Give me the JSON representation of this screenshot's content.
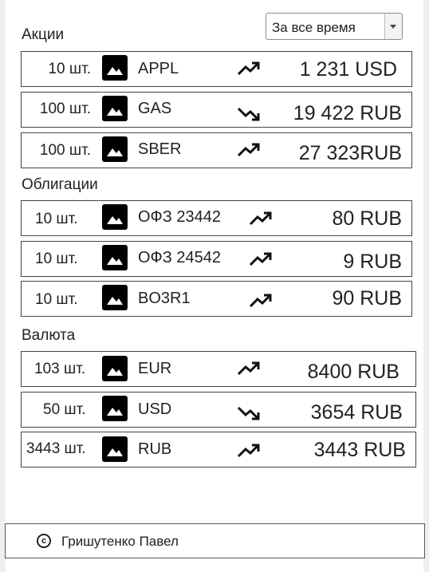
{
  "filter": {
    "period_value": "За все время"
  },
  "sections": {
    "stocks": {
      "title": "Акции",
      "rows": [
        {
          "qty": "10 шт.",
          "name": "APPL",
          "trend": "up",
          "value": "1 231 USD"
        },
        {
          "qty": "100 шт.",
          "name": "GAS",
          "trend": "down",
          "value": "19 422 RUB"
        },
        {
          "qty": "100 шт.",
          "name": "SBER",
          "trend": "up",
          "value": "27 323RUB"
        }
      ]
    },
    "bonds": {
      "title": "Облигации",
      "rows": [
        {
          "qty": "10 шт.",
          "name": "ОФЗ 23442",
          "trend": "up",
          "value": "80 RUB"
        },
        {
          "qty": "10 шт.",
          "name": "ОФЗ 24542",
          "trend": "up",
          "value": "9 RUB"
        },
        {
          "qty": "10 шт.",
          "name": "BO3R1",
          "trend": "up",
          "value": "90 RUB"
        }
      ]
    },
    "currency": {
      "title": "Валюта",
      "rows": [
        {
          "qty": "103 шт.",
          "name": "EUR",
          "trend": "up",
          "value": "8400 RUB"
        },
        {
          "qty": "50 шт.",
          "name": "USD",
          "trend": "down",
          "value": "3654 RUB"
        },
        {
          "qty": "3443 шт.",
          "name": "RUB",
          "trend": "up",
          "value": "3443 RUB"
        }
      ]
    }
  },
  "icons": {
    "asset": "image-icon",
    "trend_up": "trending-up-icon",
    "trend_down": "trending-down-icon",
    "copyright": "copyright-icon"
  },
  "footer": {
    "copyright_symbol": "c",
    "author": "Гришутенко Павел"
  }
}
